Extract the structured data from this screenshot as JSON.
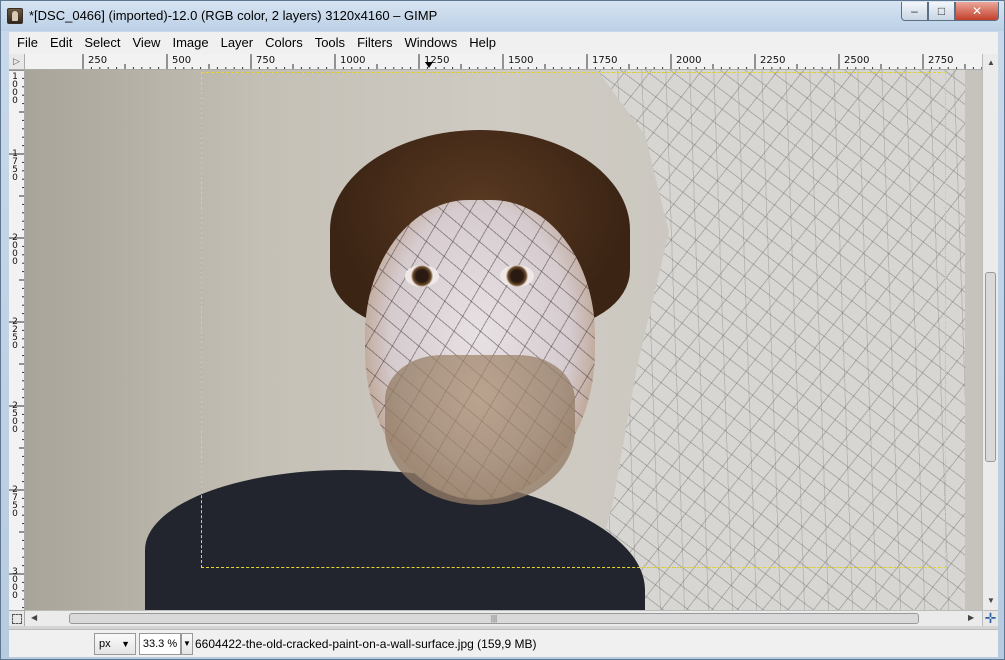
{
  "window": {
    "title": "*[DSC_0466] (imported)-12.0 (RGB color, 2 layers) 3120x4160 – GIMP",
    "controls": {
      "minimize": "–",
      "maximize": "□",
      "close": "✕"
    }
  },
  "menu": [
    "File",
    "Edit",
    "Select",
    "View",
    "Image",
    "Layer",
    "Colors",
    "Tools",
    "Filters",
    "Windows",
    "Help"
  ],
  "rulers": {
    "horizontal_ticks": [
      "250",
      "500",
      "750",
      "1000",
      "1250",
      "1500",
      "1750",
      "2000",
      "2250",
      "2500",
      "2750"
    ],
    "vertical_ticks": [
      "1000",
      "1750",
      "2000",
      "2250",
      "2500",
      "2750",
      "3000"
    ]
  },
  "statusbar": {
    "unit": "px",
    "zoom": "33.3 %",
    "message": "6604422-the-old-cracked-paint-on-a-wall-surface.jpg (159,9 MB)"
  },
  "icons": {
    "app": "gimp-icon",
    "navigate": "✛",
    "scroll_up": "▲",
    "scroll_down": "▼",
    "scroll_left": "◀",
    "scroll_right": "▶",
    "ruler_menu": "▷",
    "dropdown": "▼"
  },
  "colors": {
    "selection_dash": "#e6d92a",
    "titlebar": "#c9d9ea"
  }
}
